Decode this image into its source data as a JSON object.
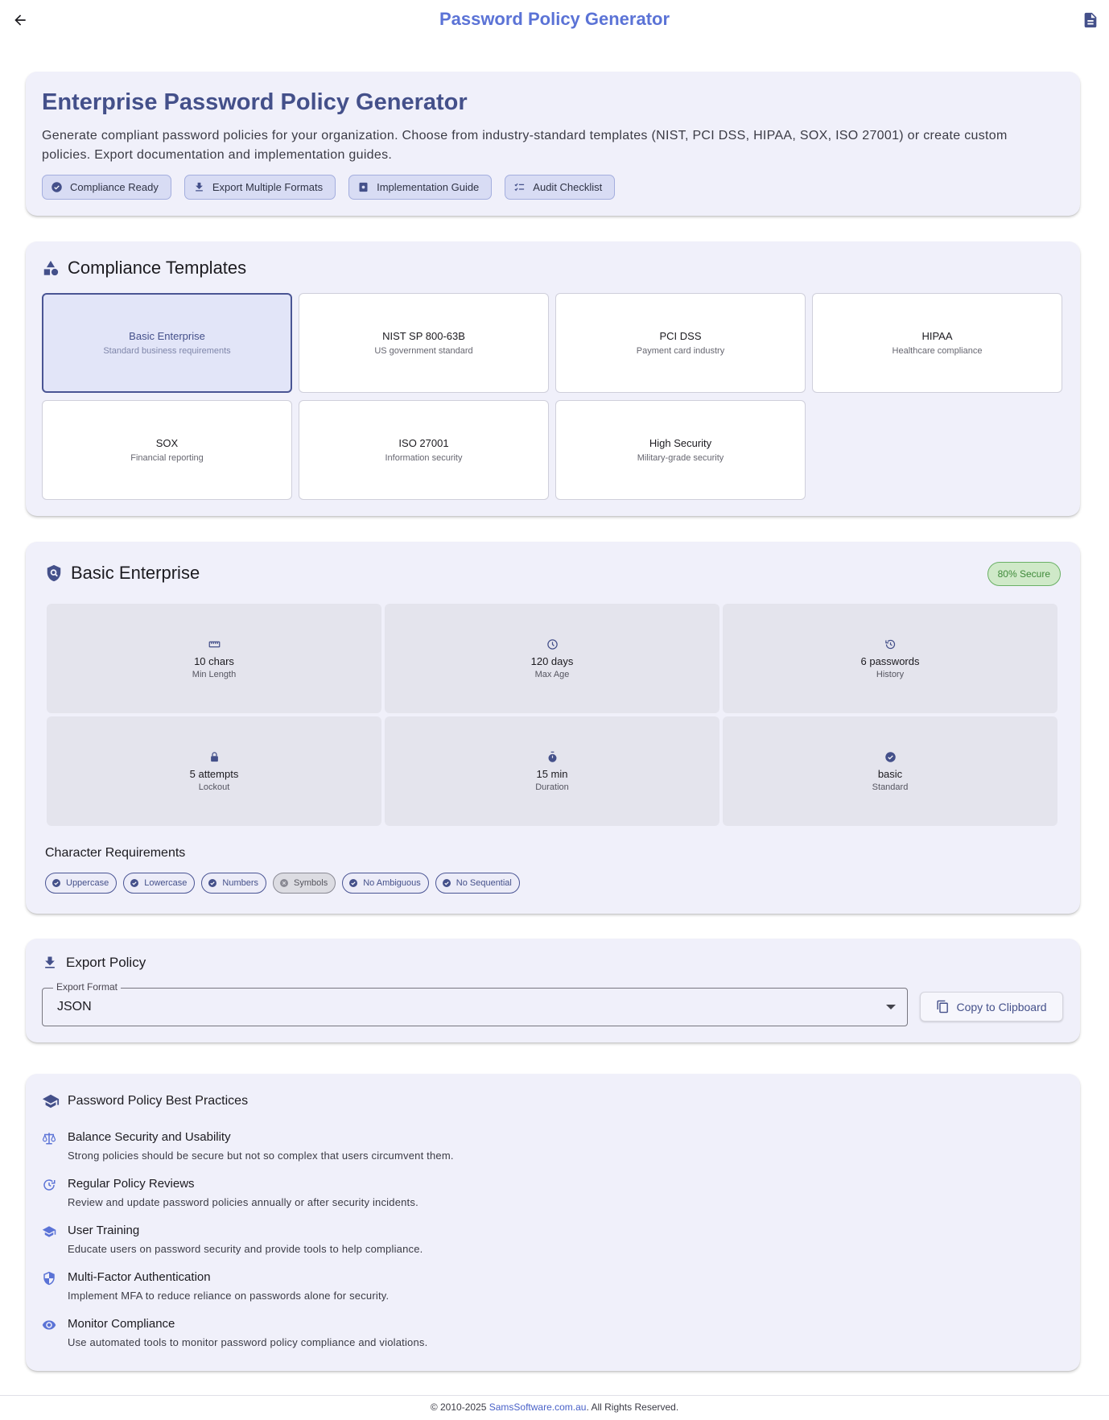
{
  "app": {
    "title": "Password Policy Generator"
  },
  "hero": {
    "title": "Enterprise Password Policy Generator",
    "description": "Generate compliant password policies for your organization. Choose from industry-standard templates (NIST, PCI DSS, HIPAA, SOX, ISO 27001) or create custom policies. Export documentation and implementation guides.",
    "chips": [
      {
        "label": "Compliance Ready",
        "icon": "verified-icon"
      },
      {
        "label": "Export Multiple Formats",
        "icon": "download-icon"
      },
      {
        "label": "Implementation Guide",
        "icon": "book-icon"
      },
      {
        "label": "Audit Checklist",
        "icon": "checklist-icon"
      }
    ]
  },
  "templates": {
    "title": "Compliance Templates",
    "items": [
      {
        "name": "Basic Enterprise",
        "desc": "Standard business requirements",
        "selected": true
      },
      {
        "name": "NIST SP 800-63B",
        "desc": "US government standard"
      },
      {
        "name": "PCI DSS",
        "desc": "Payment card industry"
      },
      {
        "name": "HIPAA",
        "desc": "Healthcare compliance"
      },
      {
        "name": "SOX",
        "desc": "Financial reporting"
      },
      {
        "name": "ISO 27001",
        "desc": "Information security"
      },
      {
        "name": "High Security",
        "desc": "Military-grade security"
      }
    ]
  },
  "policy": {
    "title": "Basic Enterprise",
    "badge": "80% Secure",
    "badge_color": "#3f8a3a",
    "stats": [
      {
        "value": "10 chars",
        "label": "Min Length",
        "icon": "ruler-icon"
      },
      {
        "value": "120 days",
        "label": "Max Age",
        "icon": "clock-icon"
      },
      {
        "value": "6 passwords",
        "label": "History",
        "icon": "history-icon"
      },
      {
        "value": "5 attempts",
        "label": "Lockout",
        "icon": "lock-icon"
      },
      {
        "value": "15 min",
        "label": "Duration",
        "icon": "timer-icon"
      },
      {
        "value": "basic",
        "label": "Standard",
        "icon": "verified-icon"
      }
    ],
    "char_title": "Character Requirements",
    "requirements": [
      {
        "label": "Uppercase",
        "enabled": true
      },
      {
        "label": "Lowercase",
        "enabled": true
      },
      {
        "label": "Numbers",
        "enabled": true
      },
      {
        "label": "Symbols",
        "enabled": false
      },
      {
        "label": "No Ambiguous",
        "enabled": true
      },
      {
        "label": "No Sequential",
        "enabled": true
      }
    ]
  },
  "export": {
    "title": "Export Policy",
    "format_label": "Export Format",
    "format_value": "JSON",
    "copy_label": "Copy to Clipboard"
  },
  "best": {
    "title": "Password Policy Best Practices",
    "items": [
      {
        "title": "Balance Security and Usability",
        "text": "Strong policies should be secure but not so complex that users circumvent them.",
        "icon": "scale-icon"
      },
      {
        "title": "Regular Policy Reviews",
        "text": "Review and update password policies annually or after security incidents.",
        "icon": "update-icon"
      },
      {
        "title": "User Training",
        "text": "Educate users on password security and provide tools to help compliance.",
        "icon": "school-icon"
      },
      {
        "title": "Multi-Factor Authentication",
        "text": "Implement MFA to reduce reliance on passwords alone for security.",
        "icon": "shield-icon"
      },
      {
        "title": "Monitor Compliance",
        "text": "Use automated tools to monitor password policy compliance and violations.",
        "icon": "eye-icon"
      }
    ]
  },
  "footer": {
    "prefix": "© 2010-2025 ",
    "link": "SamsSoftware.com.au",
    "suffix": ". All Rights Reserved."
  },
  "colors": {
    "accent": "#5b73d6",
    "primary": "#44508a",
    "card_bg": "#f0f0fa"
  }
}
